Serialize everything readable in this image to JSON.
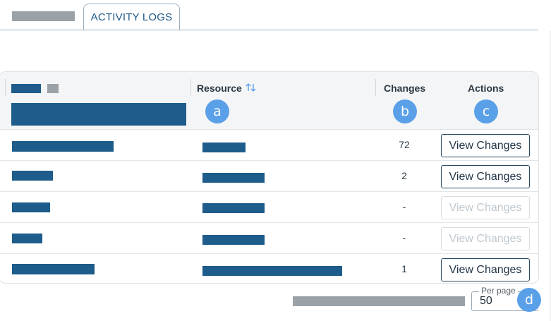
{
  "tabs": {
    "active_label": "ACTIVITY LOGS"
  },
  "table": {
    "headers": {
      "resource": "Resource",
      "changes": "Changes",
      "actions": "Actions"
    },
    "badges": {
      "a": "a",
      "b": "b",
      "c": "c",
      "d": "d"
    },
    "rows": [
      {
        "changes": "72",
        "action_label": "View Changes",
        "action_enabled": true
      },
      {
        "changes": "2",
        "action_label": "View Changes",
        "action_enabled": true
      },
      {
        "changes": "-",
        "action_label": "View Changes",
        "action_enabled": false
      },
      {
        "changes": "-",
        "action_label": "View Changes",
        "action_enabled": false
      },
      {
        "changes": "1",
        "action_label": "View Changes",
        "action_enabled": true
      }
    ]
  },
  "pagination": {
    "per_page_label": "Per page",
    "per_page_value": "50"
  },
  "colors": {
    "accent": "#205a87",
    "badge": "#5aa0e8",
    "redacted_blue": "#1d5c8b",
    "redacted_gray": "#9aa2a8"
  }
}
